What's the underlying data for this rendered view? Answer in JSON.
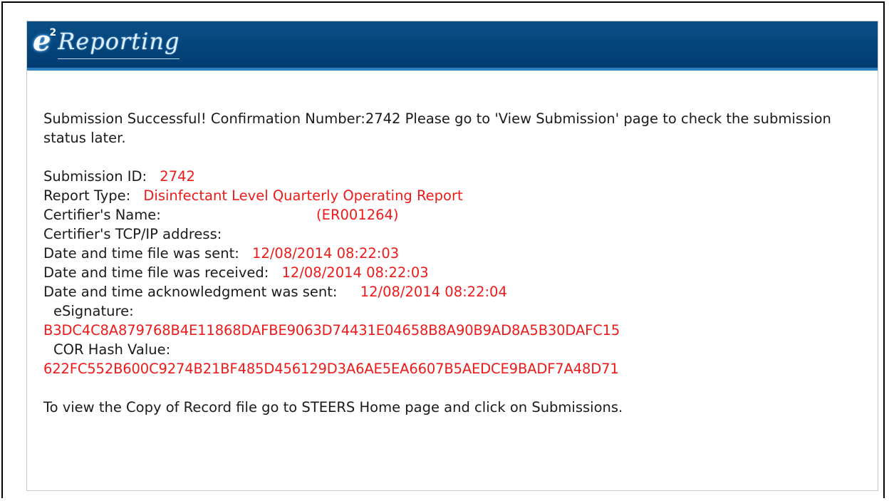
{
  "header": {
    "logo_e": "e",
    "logo_sup": "2",
    "logo_word": "Reporting"
  },
  "message": "Submission Successful! Confirmation Number:2742 Please go to 'View Submission' page to check the submission status later.",
  "details": {
    "submission_id_label": "Submission ID:",
    "submission_id_value": "2742",
    "report_type_label": "Report Type:",
    "report_type_value": "Disinfectant Level Quarterly Operating Report",
    "certifier_name_label": "Certifier's Name:",
    "certifier_name_value": "(ER001264)",
    "certifier_ip_label": "Certifier's TCP/IP address:",
    "date_sent_label": "Date and time file was sent:",
    "date_sent_value": "12/08/2014 08:22:03",
    "date_received_label": "Date and time file was received:",
    "date_received_value": "12/08/2014 08:22:03",
    "date_ack_label": "Date and time acknowledgment was sent:",
    "date_ack_value": "12/08/2014 08:22:04",
    "esignature_label": "eSignature:",
    "esignature_value": "B3DC4C8A879768B4E11868DAFBE9063D74431E04658B8A90B9AD8A5B30DAFC15",
    "cor_hash_label": "COR Hash Value:",
    "cor_hash_value": "622FC552B600C9274B21BF485D456129D3A6AE5EA6607B5AEDCE9BADF7A48D71"
  },
  "footer_note": "To view the Copy of Record file go to STEERS Home page and click on Submissions.",
  "colors": {
    "header_blue": "#04447a",
    "value_red": "#ee1a1a"
  }
}
